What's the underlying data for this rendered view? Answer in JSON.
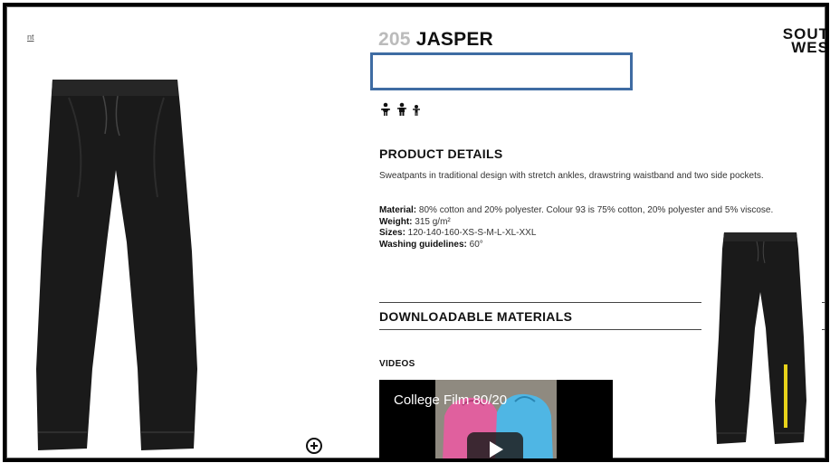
{
  "breadcrumb": {
    "text": "nt"
  },
  "product": {
    "number": "205",
    "name": "JASPER",
    "brand_line1": "SOUT",
    "brand_line2": "WES",
    "gender_icons": [
      "woman-icon",
      "man-icon",
      "child-icon"
    ]
  },
  "details": {
    "heading": "PRODUCT DETAILS",
    "description": "Sweatpants in traditional design with stretch ankles, drawstring waistband and two side pockets.",
    "material_label": "Material:",
    "material_value": " 80% cotton and 20% polyester. Colour 93 is 75% cotton, 20% polyester and 5% viscose.",
    "weight_label": "Weight:",
    "weight_value": " 315 g/m²",
    "sizes_label": "Sizes:",
    "sizes_value": " 120-140-160-XS-S-M-L-XL-XXL",
    "washing_label": "Washing guidelines:",
    "washing_value": " 60°"
  },
  "downloads": {
    "heading": "DOWNLOADABLE MATERIALS"
  },
  "videos": {
    "heading": "VIDEOS",
    "video_title": "College Film 80/20"
  },
  "colors": {
    "highlight_border": "#3f6ca3",
    "product_number": "#bbbbbb",
    "garment": "#1a1a1a",
    "hoodie_pink": "#e0609e",
    "hoodie_blue": "#4fb6e4",
    "accent_yellow": "#e8d21a"
  }
}
